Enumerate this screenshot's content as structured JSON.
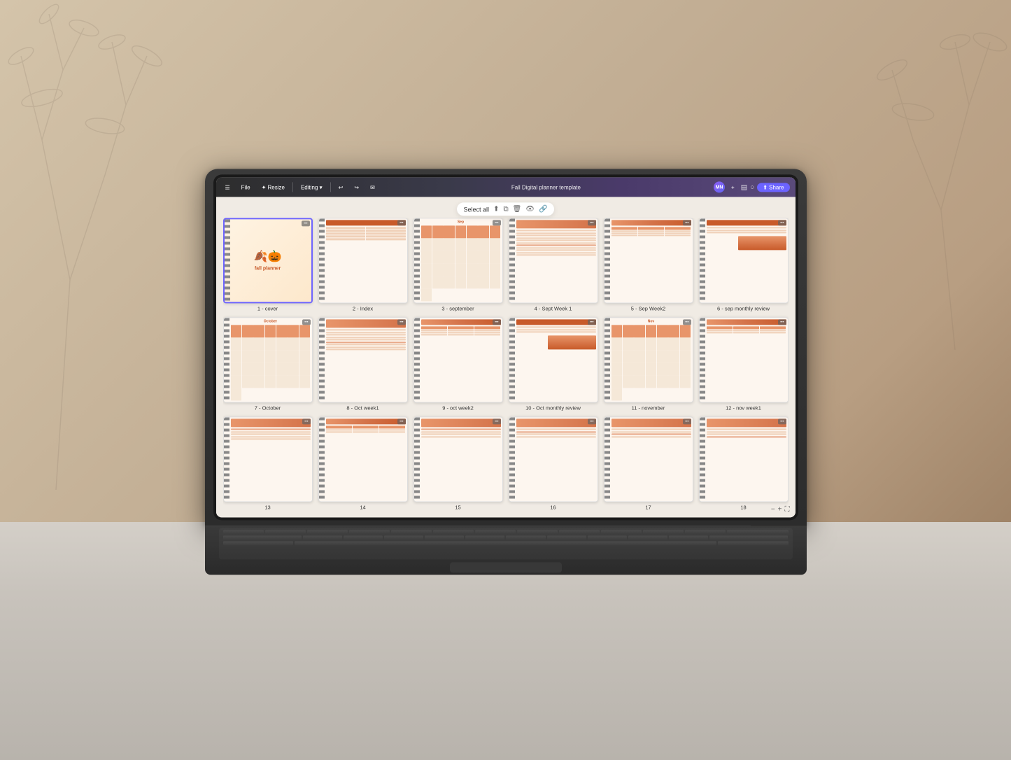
{
  "background": {
    "colors": {
      "main": "#c8b89a",
      "table": "#d0cbc4",
      "dark_panel": "#5a4a3a"
    }
  },
  "toolbar": {
    "file_label": "File",
    "resize_label": "✦ Resize",
    "editing_label": "Editing ▾",
    "undo_label": "↩",
    "redo_label": "↪",
    "title": "Fall Digital planner template",
    "avatar": "MN",
    "plus_label": "+",
    "share_label": "⬆ Share"
  },
  "select_bar": {
    "select_all_label": "Select all",
    "icons": [
      "upload",
      "copy",
      "trash",
      "eye",
      "link"
    ]
  },
  "pages": [
    {
      "id": 1,
      "label": "1 - cover",
      "type": "cover",
      "selected": true
    },
    {
      "id": 2,
      "label": "2 - Index",
      "type": "index",
      "selected": false
    },
    {
      "id": 3,
      "label": "3 - september",
      "type": "calendar",
      "selected": false
    },
    {
      "id": 4,
      "label": "4 - Sept Week 1",
      "type": "week",
      "selected": false
    },
    {
      "id": 5,
      "label": "5 - Sep Week2",
      "type": "week",
      "selected": false
    },
    {
      "id": 6,
      "label": "6 - sep monthly review",
      "type": "monthly_review",
      "selected": false
    },
    {
      "id": 7,
      "label": "7 - October",
      "type": "october",
      "selected": false
    },
    {
      "id": 8,
      "label": "8 - Oct week1",
      "type": "week",
      "selected": false
    },
    {
      "id": 9,
      "label": "9 - oct week2",
      "type": "week",
      "selected": false
    },
    {
      "id": 10,
      "label": "10 - Oct monthly review",
      "type": "monthly_review",
      "selected": false
    },
    {
      "id": 11,
      "label": "11 - november",
      "type": "calendar",
      "selected": false
    },
    {
      "id": 12,
      "label": "12 - nov week1",
      "type": "week",
      "selected": false
    },
    {
      "id": 13,
      "label": "13",
      "type": "week",
      "selected": false
    },
    {
      "id": 14,
      "label": "14",
      "type": "week",
      "selected": false
    },
    {
      "id": 15,
      "label": "15",
      "type": "week",
      "selected": false
    },
    {
      "id": 16,
      "label": "16",
      "type": "week",
      "selected": false
    },
    {
      "id": 17,
      "label": "17",
      "type": "week",
      "selected": false
    },
    {
      "id": 18,
      "label": "18",
      "type": "week",
      "selected": false
    }
  ],
  "cover": {
    "title": "fall\nplanner",
    "emoji": "🍂",
    "pumpkin": "🎃"
  },
  "october": {
    "text": "October"
  }
}
